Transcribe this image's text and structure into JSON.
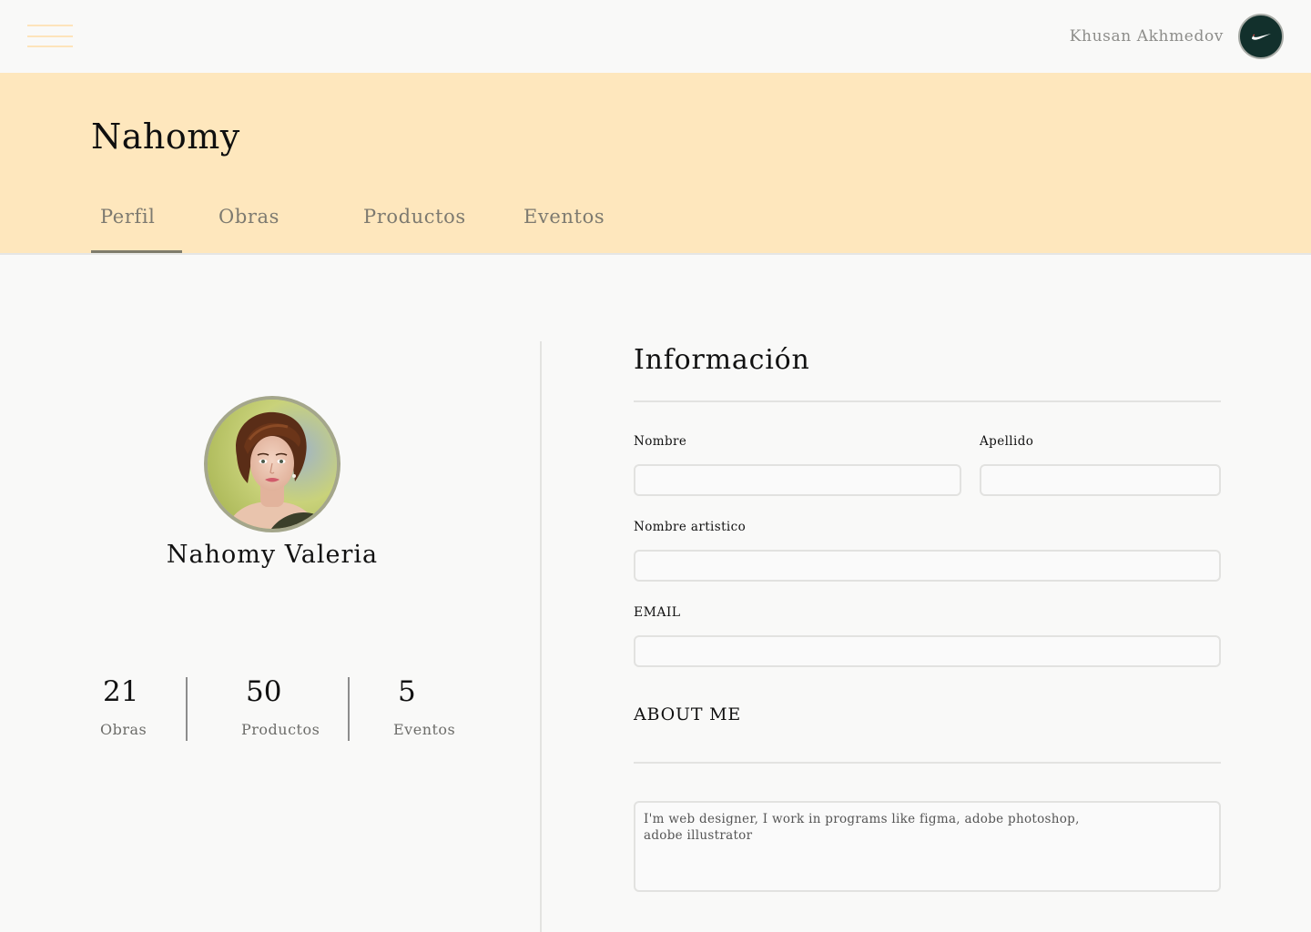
{
  "topbar": {
    "menu_icon": "hamburger-menu-icon",
    "user_name": "Khusan Akhmedov",
    "avatar_icon": "nike-swoosh-logo"
  },
  "header": {
    "title": "Nahomy",
    "tabs": [
      {
        "label": "Perfil",
        "active": true
      },
      {
        "label": "Obras",
        "active": false
      },
      {
        "label": "Productos",
        "active": false
      },
      {
        "label": "Eventos",
        "active": false
      }
    ]
  },
  "profile": {
    "name": "Nahomy Valeria",
    "stats": [
      {
        "value": "21",
        "label": "Obras"
      },
      {
        "value": "50",
        "label": "Productos"
      },
      {
        "value": "5",
        "label": "Eventos"
      }
    ]
  },
  "info": {
    "title": "Información",
    "fields": {
      "nombre": {
        "label": "Nombre",
        "value": ""
      },
      "apellido": {
        "label": "Apellido",
        "value": ""
      },
      "nombre_artistico": {
        "label": "Nombre artistico",
        "value": ""
      },
      "email": {
        "label": "EMAIL",
        "value": ""
      }
    },
    "about": {
      "title": "ABOUT ME",
      "value": "I'm web designer, I work in programs like figma, adobe photoshop, adobe illustrator"
    }
  },
  "colors": {
    "header_bg": "#fee7bd",
    "page_bg": "#f9f9f8",
    "tab_underline": "#7f7c6b",
    "avatar_bg": "#12302c"
  }
}
